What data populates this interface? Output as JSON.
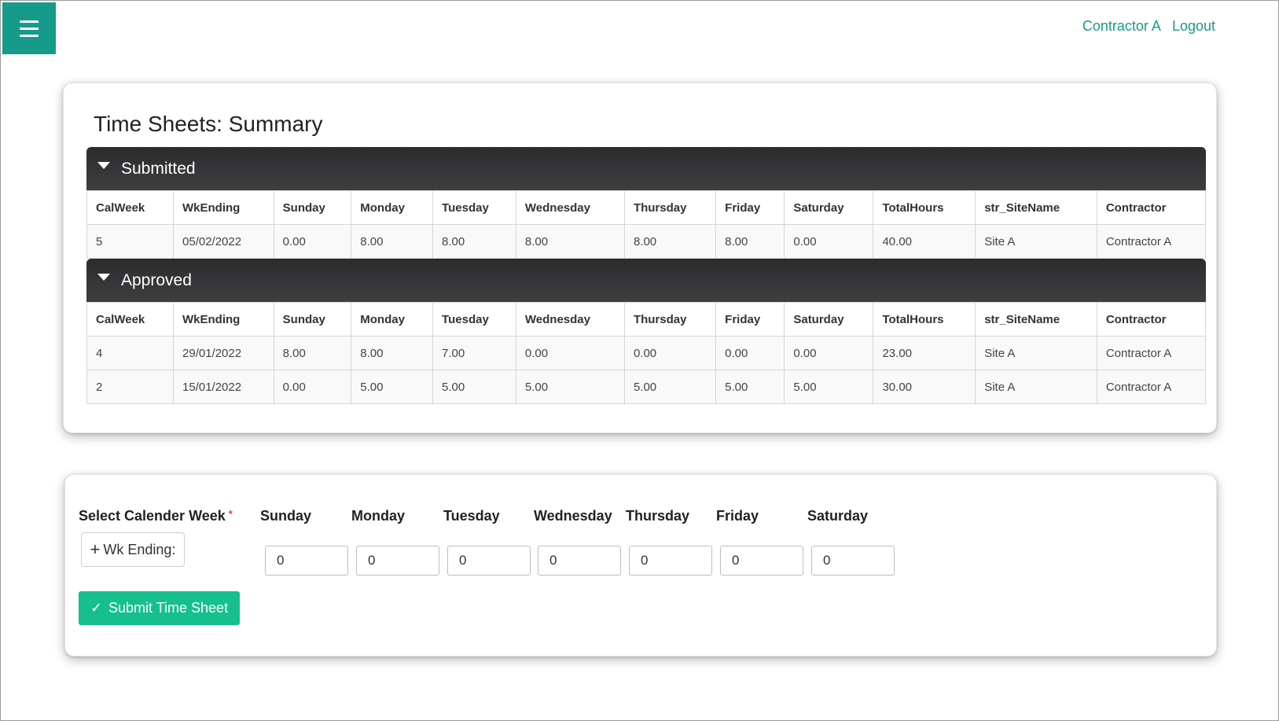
{
  "header": {
    "user": "Contractor A",
    "logout": "Logout"
  },
  "summary": {
    "title": "Time Sheets: Summary",
    "columns": [
      "CalWeek",
      "WkEnding",
      "Sunday",
      "Monday",
      "Tuesday",
      "Wednesday",
      "Thursday",
      "Friday",
      "Saturday",
      "TotalHours",
      "str_SiteName",
      "Contractor"
    ],
    "submitted": {
      "label": "Submitted",
      "rows": [
        [
          "5",
          "05/02/2022",
          "0.00",
          "8.00",
          "8.00",
          "8.00",
          "8.00",
          "8.00",
          "0.00",
          "40.00",
          "Site A",
          "Contractor A"
        ]
      ]
    },
    "approved": {
      "label": "Approved",
      "rows": [
        [
          "4",
          "29/01/2022",
          "8.00",
          "8.00",
          "7.00",
          "0.00",
          "0.00",
          "0.00",
          "0.00",
          "23.00",
          "Site A",
          "Contractor A"
        ],
        [
          "2",
          "15/01/2022",
          "0.00",
          "5.00",
          "5.00",
          "5.00",
          "5.00",
          "5.00",
          "5.00",
          "30.00",
          "Site A",
          "Contractor A"
        ]
      ]
    }
  },
  "entry": {
    "select_week_label": "Select Calender Week",
    "required_mark": "*",
    "wk_ending_button": "Wk Ending:",
    "days": [
      "Sunday",
      "Monday",
      "Tuesday",
      "Wednesday",
      "Thursday",
      "Friday",
      "Saturday"
    ],
    "values": [
      "0",
      "0",
      "0",
      "0",
      "0",
      "0",
      "0"
    ],
    "submit_label": "Submit Time Sheet"
  },
  "colors": {
    "accent": "#169b8a",
    "submit": "#15c08d",
    "section_bar": "#333436"
  }
}
